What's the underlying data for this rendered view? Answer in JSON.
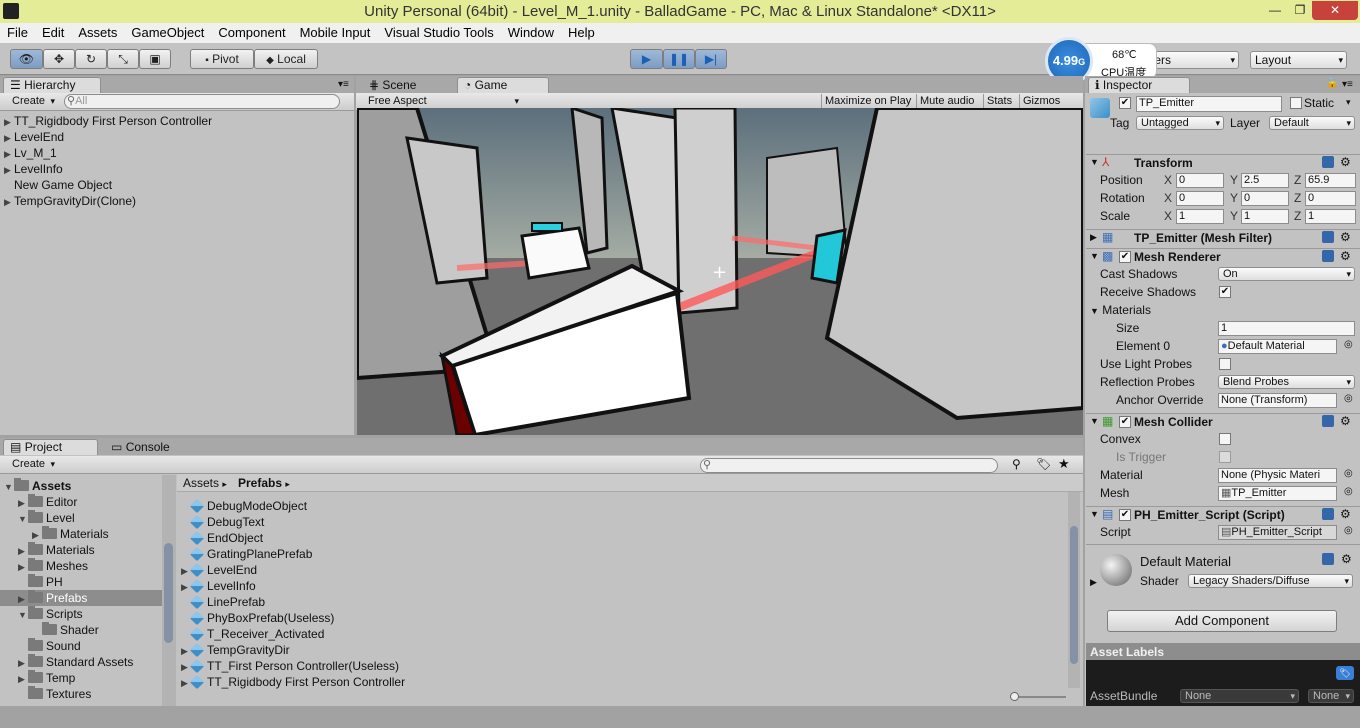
{
  "window": {
    "title": "Unity Personal (64bit) - Level_M_1.unity - BalladGame - PC, Mac & Linux Standalone* <DX11>",
    "btn_min": "—",
    "btn_max": "❐",
    "btn_close": "✕"
  },
  "menu": [
    "File",
    "Edit",
    "Assets",
    "GameObject",
    "Component",
    "Mobile Input",
    "Visual Studio Tools",
    "Window",
    "Help"
  ],
  "toolbar": {
    "pivot": "Pivot",
    "local": "Local",
    "layers": "Layers",
    "layout": "Layout"
  },
  "overlay": {
    "fps": "4.99",
    "fps_unit": "G",
    "temp": "68℃",
    "temp_label": "CPU温度"
  },
  "hierarchy": {
    "tab": "Hierarchy",
    "create": "Create",
    "search_placeholder": "All",
    "items": [
      {
        "label": "TT_Rigidbody First Person Controller",
        "arrow": "▶"
      },
      {
        "label": "LevelEnd",
        "arrow": "▶"
      },
      {
        "label": "Lv_M_1",
        "arrow": "▶"
      },
      {
        "label": "LevelInfo",
        "arrow": "▶"
      },
      {
        "label": "New Game Object",
        "arrow": ""
      },
      {
        "label": "TempGravityDir(Clone)",
        "arrow": "▶"
      }
    ]
  },
  "view": {
    "tab_scene": "Scene",
    "tab_game": "Game",
    "aspect": "Free Aspect",
    "buttons": [
      "Maximize on Play",
      "Mute audio",
      "Stats",
      "Gizmos"
    ]
  },
  "project": {
    "tab_project": "Project",
    "tab_console": "Console",
    "create": "Create",
    "breadcrumb": [
      "Assets",
      "Prefabs"
    ],
    "folders": [
      {
        "label": "Assets",
        "level": 0,
        "arrow": "▼",
        "bold": true
      },
      {
        "label": "Editor",
        "level": 1,
        "arrow": "▶"
      },
      {
        "label": "Level",
        "level": 1,
        "arrow": "▼"
      },
      {
        "label": "Materials",
        "level": 2,
        "arrow": "▶"
      },
      {
        "label": "Materials",
        "level": 1,
        "arrow": "▶"
      },
      {
        "label": "Meshes",
        "level": 1,
        "arrow": "▶"
      },
      {
        "label": "PH",
        "level": 1,
        "arrow": ""
      },
      {
        "label": "Prefabs",
        "level": 1,
        "arrow": "▶",
        "selected": true
      },
      {
        "label": "Scripts",
        "level": 1,
        "arrow": "▼"
      },
      {
        "label": "Shader",
        "level": 2,
        "arrow": ""
      },
      {
        "label": "Sound",
        "level": 1,
        "arrow": ""
      },
      {
        "label": "Standard Assets",
        "level": 1,
        "arrow": "▶"
      },
      {
        "label": "Temp",
        "level": 1,
        "arrow": "▶"
      },
      {
        "label": "Textures",
        "level": 1,
        "arrow": ""
      }
    ],
    "assets": [
      {
        "label": "DebugModeObject",
        "arrow": ""
      },
      {
        "label": "DebugText",
        "arrow": ""
      },
      {
        "label": "EndObject",
        "arrow": ""
      },
      {
        "label": "GratingPlanePrefab",
        "arrow": ""
      },
      {
        "label": "LevelEnd",
        "arrow": "▶"
      },
      {
        "label": "LevelInfo",
        "arrow": "▶"
      },
      {
        "label": "LinePrefab",
        "arrow": ""
      },
      {
        "label": "PhyBoxPrefab(Useless)",
        "arrow": ""
      },
      {
        "label": "T_Receiver_Activated",
        "arrow": ""
      },
      {
        "label": "TempGravityDir",
        "arrow": "▶"
      },
      {
        "label": "TT_First Person Controller(Useless)",
        "arrow": "▶"
      },
      {
        "label": "TT_Rigidbody First Person Controller",
        "arrow": "▶"
      }
    ]
  },
  "inspector": {
    "tab": "Inspector",
    "object_name": "TP_Emitter",
    "static": "Static",
    "tag_label": "Tag",
    "tag": "Untagged",
    "layer_label": "Layer",
    "layer": "Default",
    "transform": {
      "title": "Transform",
      "rows": [
        {
          "label": "Position",
          "x": "0",
          "y": "2.5",
          "z": "65.9"
        },
        {
          "label": "Rotation",
          "x": "0",
          "y": "0",
          "z": "0"
        },
        {
          "label": "Scale",
          "x": "1",
          "y": "1",
          "z": "1"
        }
      ]
    },
    "mesh_filter": "TP_Emitter (Mesh Filter)",
    "mesh_renderer": {
      "title": "Mesh Renderer",
      "cast_shadows_label": "Cast Shadows",
      "cast_shadows": "On",
      "receive_shadows_label": "Receive Shadows",
      "materials_label": "Materials",
      "size_label": "Size",
      "size": "1",
      "element0_label": "Element 0",
      "element0": "Default Material",
      "light_probes_label": "Use Light Probes",
      "reflection_label": "Reflection Probes",
      "reflection": "Blend Probes",
      "anchor_label": "Anchor Override",
      "anchor": "None (Transform)"
    },
    "mesh_collider": {
      "title": "Mesh Collider",
      "convex_label": "Convex",
      "trigger_label": "Is Trigger",
      "material_label": "Material",
      "material": "None (Physic Materi",
      "mesh_label": "Mesh",
      "mesh": "TP_Emitter"
    },
    "script_comp": {
      "title": "PH_Emitter_Script (Script)",
      "script_label": "Script",
      "script": "PH_Emitter_Script"
    },
    "material": {
      "name": "Default Material",
      "shader_label": "Shader",
      "shader": "Legacy Shaders/Diffuse"
    },
    "add_component": "Add Component",
    "asset_labels": "Asset Labels",
    "assetbundle_label": "AssetBundle",
    "assetbundle": "None",
    "assetbundle_variant": "None"
  },
  "axes": {
    "x": "X",
    "y": "Y",
    "z": "Z"
  }
}
